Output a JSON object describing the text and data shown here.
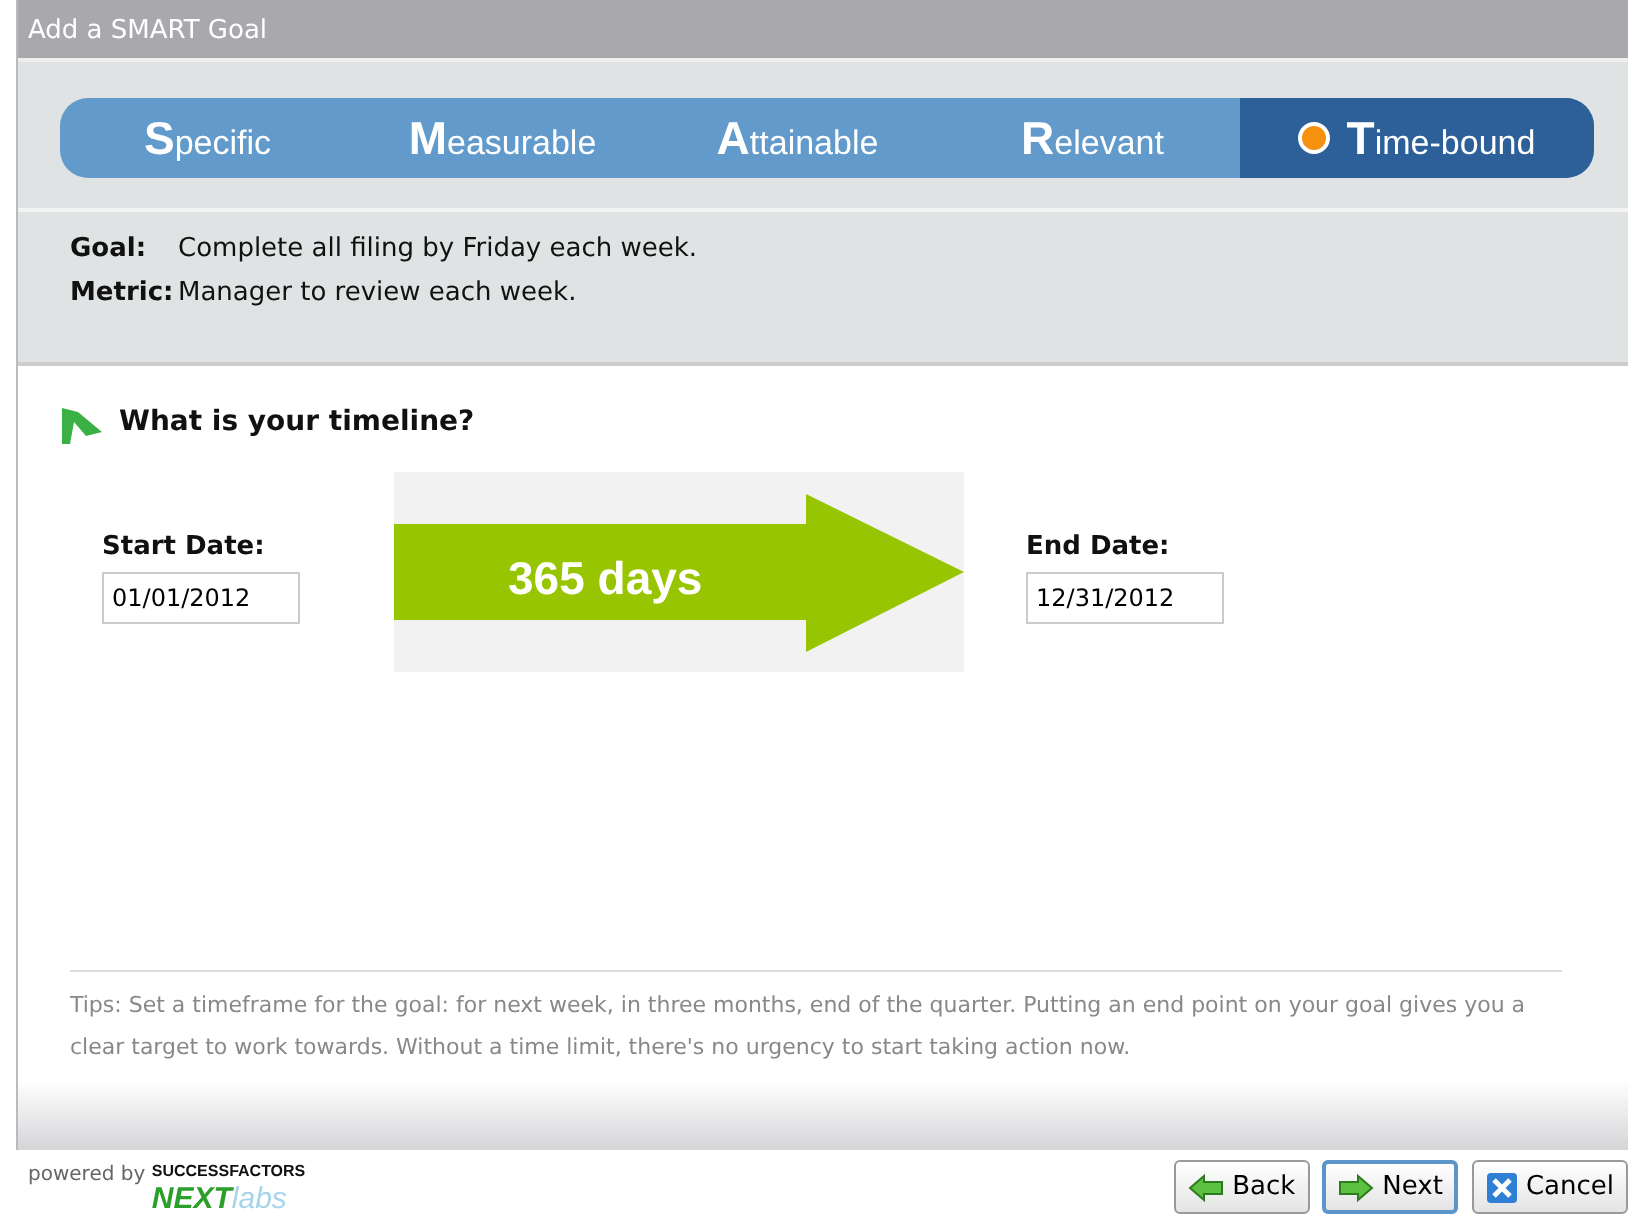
{
  "window": {
    "title": "Add a SMART Goal"
  },
  "steps": [
    {
      "label": "Specific",
      "selected": false
    },
    {
      "label": "Measurable",
      "selected": false
    },
    {
      "label": "Attainable",
      "selected": false
    },
    {
      "label": "Relevant",
      "selected": false
    },
    {
      "label": "Time-bound",
      "selected": true
    }
  ],
  "summary": [
    {
      "label": "Goal:",
      "value": "Complete all filing by Friday each week."
    },
    {
      "label": "Metric:",
      "value": "Manager to review each week."
    }
  ],
  "question": "What is your timeline?",
  "start_date": {
    "label": "Start Date:",
    "value": "01/01/2012"
  },
  "duration": "365 days",
  "end_date": {
    "label": "End Date:",
    "value": "12/31/2012"
  },
  "tips": "Tips: Set a timeframe for the goal: for next week, in three months, end of the quarter. Putting an end point on your goal gives you a clear target to work towards. Without a time limit, there's no urgency to start taking action now.",
  "footer": {
    "powered_by": "powered by",
    "brand_top": "SUCCESSFACTORS",
    "brand_next": "NEXT",
    "brand_labs": "labs"
  },
  "buttons": [
    {
      "label": "Back",
      "kind": "back",
      "focused": false
    },
    {
      "label": "Next",
      "kind": "next",
      "focused": true
    },
    {
      "label": "Cancel",
      "kind": "cancel",
      "focused": false
    }
  ]
}
